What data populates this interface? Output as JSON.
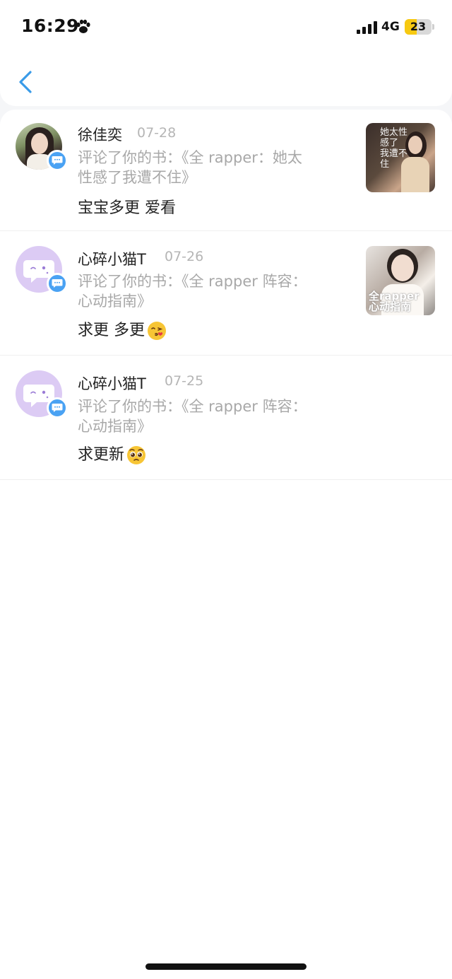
{
  "status_bar": {
    "time": "16:29",
    "network": "4G",
    "battery": "23",
    "battery_level": 0.23
  },
  "header": {
    "back_icon": "chevron-left-icon",
    "accent_color": "#3a9be8"
  },
  "comments": [
    {
      "name": "徐佳奕",
      "date": "07-28",
      "meta": "评论了你的书：《全 rapper：她太性感了我遭不住》",
      "meta_line1": "评论了你的书：《全 rapper：她太",
      "meta_line2": "性感了我遭不住》",
      "comment": "宝宝多更 爱看",
      "emoji": "",
      "thumb_text": "她太性\n感了\n我遭不\n住"
    },
    {
      "name": "心碎小猫T",
      "date": "07-26",
      "meta_line1": "评论了你的书：《全 rapper 阵容：",
      "meta_line2": "心动指南》",
      "comment": "求更 多更",
      "emoji": "kissing-face-emoji",
      "thumb_text": "全rapper\n心动指南"
    },
    {
      "name": "心碎小猫T",
      "date": "07-25",
      "meta_line1": "评论了你的书：《全 rapper 阵容：",
      "meta_line2": "心动指南》",
      "comment": "求更新",
      "emoji": "pleading-face-emoji"
    }
  ],
  "badge_color": "#4aa2f3"
}
